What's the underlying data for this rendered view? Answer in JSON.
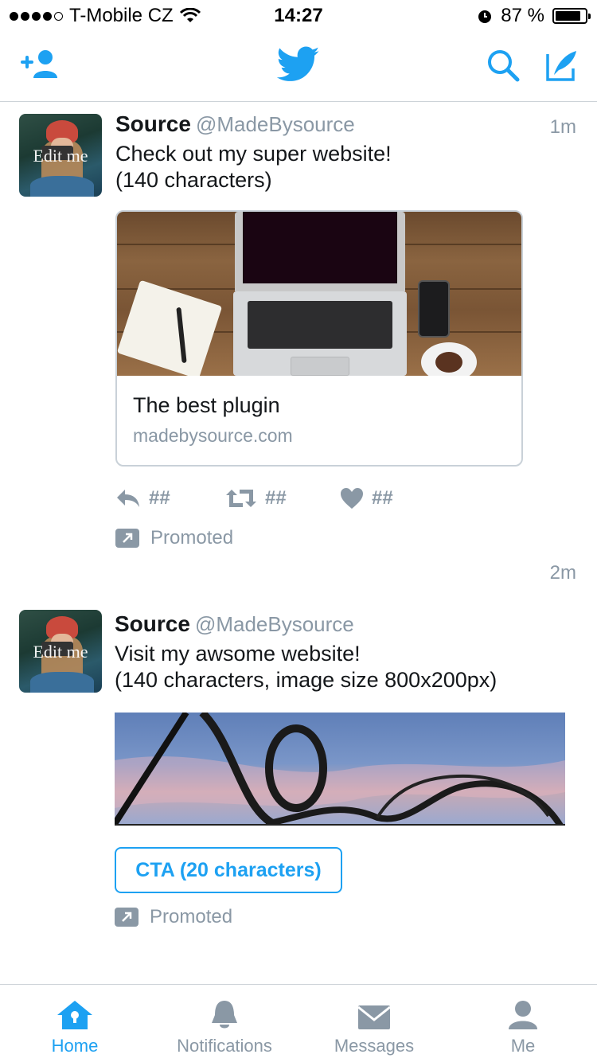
{
  "status_bar": {
    "carrier": "T-Mobile CZ",
    "time": "14:27",
    "battery": "87 %",
    "battery_level": 0.87
  },
  "nav_bar": {
    "icons": [
      "add-user-icon",
      "twitter-bird-icon",
      "search-icon",
      "compose-icon"
    ]
  },
  "tweets": [
    {
      "name": "Source",
      "handle": "@MadeBysource",
      "time": "1m",
      "avatar_text": "Edit me",
      "text_line1": "Check out my super website!",
      "text_line2": "(140 characters)",
      "card": {
        "title": "The best plugin",
        "url": "madebysource.com"
      },
      "actions": {
        "reply": "##",
        "retweet": "##",
        "like": "##"
      },
      "promoted": "Promoted"
    },
    {
      "name": "Source",
      "handle": "@MadeBysource",
      "time": "2m",
      "avatar_text": "Edit me",
      "text_line1": "Visit my awsome website!",
      "text_line2": "(140 characters, image size 800x200px)",
      "cta": "CTA (20 characters)",
      "promoted": "Promoted"
    }
  ],
  "tab_bar": {
    "tabs": [
      {
        "label": "Home",
        "icon": "home-icon",
        "active": true
      },
      {
        "label": "Notifications",
        "icon": "bell-icon",
        "active": false
      },
      {
        "label": "Messages",
        "icon": "envelope-icon",
        "active": false
      },
      {
        "label": "Me",
        "icon": "person-icon",
        "active": false
      }
    ]
  },
  "colors": {
    "accent": "#1da1f2",
    "muted": "#8a98a5",
    "text": "#14171a",
    "border": "#cdd3d8"
  }
}
